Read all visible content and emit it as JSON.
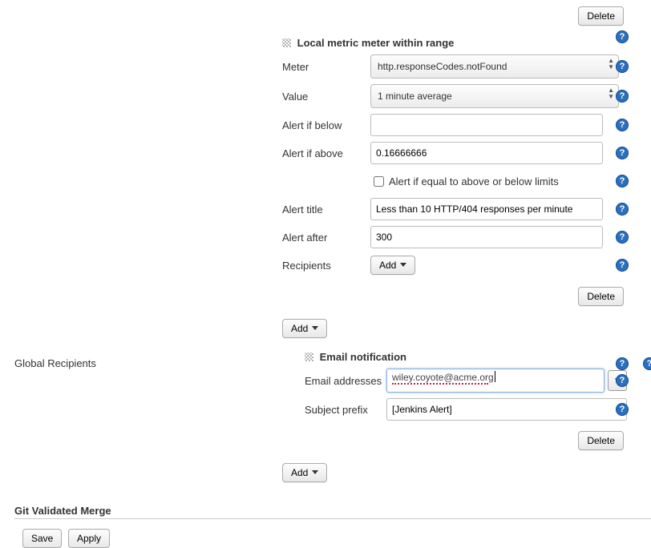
{
  "buttons": {
    "delete": "Delete",
    "add": "Add",
    "save": "Save",
    "apply": "Apply"
  },
  "localMetric": {
    "title": "Local metric meter within range",
    "meterLabel": "Meter",
    "meterValue": "http.responseCodes.notFound",
    "valueLabel": "Value",
    "valueSelected": "1 minute average",
    "alertBelowLabel": "Alert if below",
    "alertBelowValue": "",
    "alertAboveLabel": "Alert if above",
    "alertAboveValue": "0.16666666",
    "equalCheckboxLabel": "Alert if equal to above or below limits",
    "equalChecked": false,
    "alertTitleLabel": "Alert title",
    "alertTitleValue": "Less than 10 HTTP/404 responses per minute",
    "alertAfterLabel": "Alert after",
    "alertAfterValue": "300",
    "recipientsLabel": "Recipients"
  },
  "globalRecipients": {
    "sideLabel": "Global Recipients",
    "emailNotif": {
      "title": "Email notification",
      "emailLabel": "Email addresses",
      "emailValue": "wiley.coyote@acme.org",
      "emailSpell1": "wiley.coyote@acme.or",
      "emailTail": "g",
      "subjectLabel": "Subject prefix",
      "subjectValue": "[Jenkins Alert]"
    }
  },
  "gitSection": "Git Validated Merge"
}
